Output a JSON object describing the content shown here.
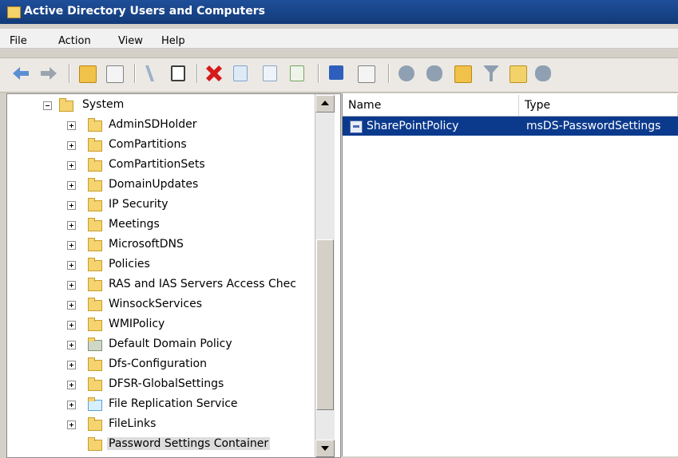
{
  "window": {
    "title": "Active Directory Users and Computers"
  },
  "menu": [
    "File",
    "Action",
    "View",
    "Help"
  ],
  "toolbar": {
    "buttons": [
      "back-icon",
      "forward-icon",
      "up-folder-icon",
      "show-console-tree-icon",
      "cut-icon",
      "copy-icon",
      "delete-icon",
      "properties-icon",
      "refresh-icon",
      "export-list-icon",
      "help-icon",
      "console-tree-icon",
      "users-icon",
      "group-icon",
      "ou-icon",
      "filter-icon",
      "find-icon",
      "add-to-group-icon"
    ]
  },
  "tree": {
    "root": "System",
    "items": [
      "AdminSDHolder",
      "ComPartitions",
      "ComPartitionSets",
      "DomainUpdates",
      "IP Security",
      "Meetings",
      "MicrosoftDNS",
      "Policies",
      "RAS and IAS Servers Access Chec",
      "WinsockServices",
      "WMIPolicy",
      "Default Domain Policy",
      "Dfs-Configuration",
      "DFSR-GlobalSettings",
      "File Replication Service",
      "FileLinks",
      "Password Settings Container"
    ]
  },
  "list": {
    "columns": [
      "Name",
      "Type"
    ],
    "rows": [
      {
        "name": "SharePointPolicy",
        "type": "msDS-PasswordSettings"
      }
    ]
  },
  "colors": {
    "titlebar": "#1f4f9a",
    "selection": "#0b3a8d",
    "folder": "#f5d36f"
  }
}
